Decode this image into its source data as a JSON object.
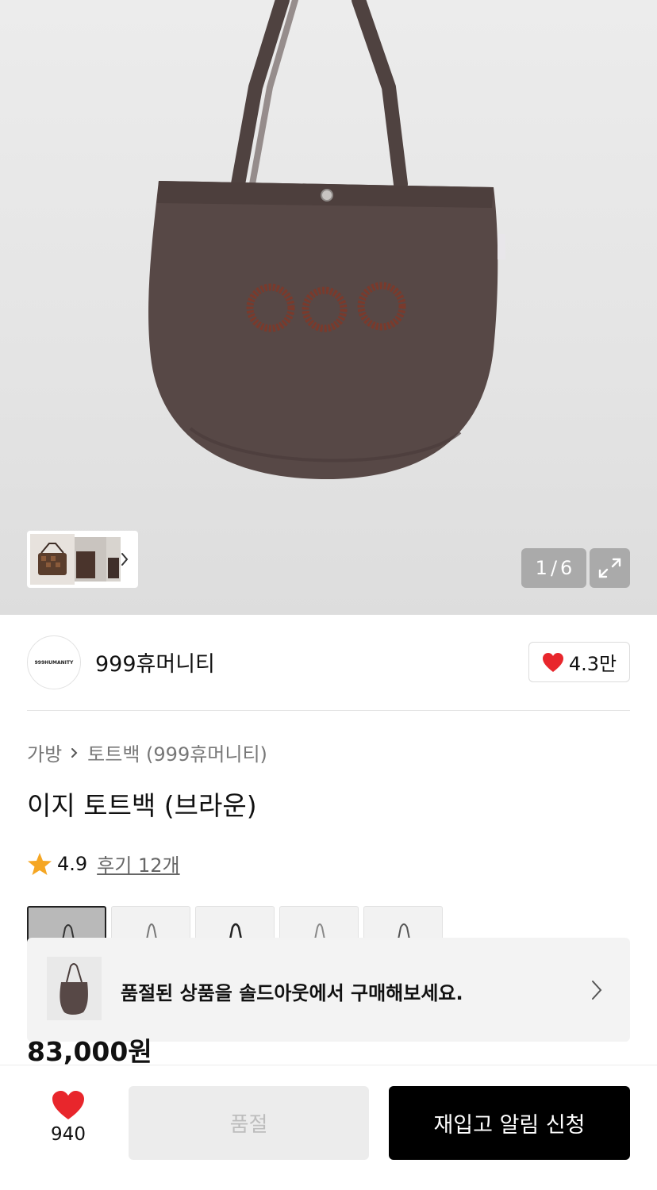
{
  "gallery": {
    "current": "1",
    "separator": "/",
    "total": "6",
    "image_alt": "brown tote bag with embroidered 999 logo"
  },
  "brand": {
    "logo_text": "999HUMANITY",
    "name": "999휴머니티",
    "like_count": "4.3만"
  },
  "breadcrumb": {
    "category": "가방",
    "subcategory": "토트백 (999휴머니티)"
  },
  "product": {
    "title": "이지 토트백 (브라운)",
    "rating": "4.9",
    "reviews_label": "후기 12개",
    "price": "83,000원"
  },
  "soldout_banner": {
    "text": "품절된 상품을 솔드아웃에서 구매해보세요."
  },
  "bottom_bar": {
    "wish_count": "940",
    "soldout_label": "품절",
    "restock_label": "재입고 알림 신청"
  },
  "colors": {
    "accent_red": "#e8262c",
    "star": "#f5a623",
    "primary_button": "#000000",
    "bag_brown": "#574846"
  }
}
